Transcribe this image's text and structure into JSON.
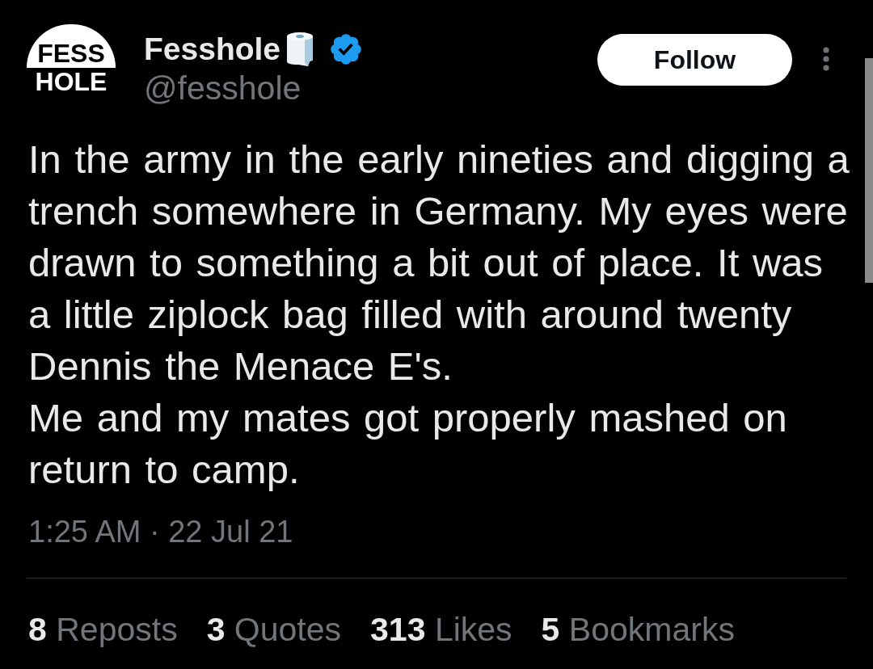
{
  "author": {
    "avatar_text": [
      "FESS",
      "HOLE"
    ],
    "name": "Fesshole",
    "verified": true,
    "handle": "@fesshole"
  },
  "follow_button": {
    "label": "Follow"
  },
  "tweet": {
    "paragraphs": [
      "In the army in the early nineties and digging a trench somewhere in Germany. My eyes were drawn to something a bit out of place. It was a little ziplock bag filled with around twenty Dennis the Menace E's.",
      "Me and my mates got properly mashed on return to camp."
    ],
    "timestamp": "1:25 AM · 22 Jul 21"
  },
  "stats": [
    {
      "count": "8",
      "label": "Reposts"
    },
    {
      "count": "3",
      "label": "Quotes"
    },
    {
      "count": "313",
      "label": "Likes"
    },
    {
      "count": "5",
      "label": "Bookmarks"
    }
  ]
}
